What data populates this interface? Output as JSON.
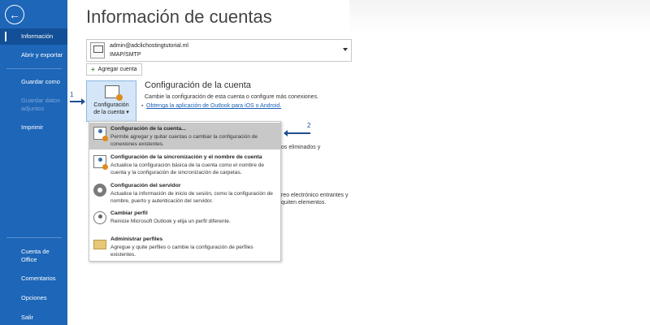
{
  "sidebar": {
    "back_icon": "back-arrow-icon",
    "items": [
      {
        "label": "Información",
        "active": true
      },
      {
        "label": "Abrir y exportar"
      },
      {
        "label": "Guardar como"
      },
      {
        "label": "Guardar datos adjuntos",
        "disabled": true
      },
      {
        "label": "Imprimir"
      },
      {
        "label": "Cuenta de Office"
      },
      {
        "label": "Comentarios"
      },
      {
        "label": "Opciones"
      },
      {
        "label": "Salir"
      }
    ],
    "color": "#1d66b8"
  },
  "page": {
    "title": "Información de cuentas"
  },
  "account": {
    "email": "admin@adclichostingtutorial.ml",
    "type": "IMAP/SMTP",
    "add_label": "Agregar cuenta"
  },
  "account_settings": {
    "button_label_line1": "Configuración",
    "button_label_line2": "de la cuenta",
    "section_title": "Configuración de la cuenta",
    "section_desc": "Cambie la configuración de esta cuenta o configure más conexiones.",
    "link": "Obtenga la aplicación de Outlook para iOS o Android."
  },
  "annotations": {
    "step1": "1",
    "step2": "2"
  },
  "background_text": {
    "frag1": "os eliminados y",
    "frag2": "reo electrónico entrantes y",
    "frag3": "quiten elementos."
  },
  "menu": {
    "items": [
      {
        "title": "Configuración de la cuenta...",
        "desc": "Permite agregar y quitar cuentas o cambiar la configuración de conexiones existentes.",
        "icon": "account-settings-icon",
        "hover": true
      },
      {
        "title": "Configuración de la sincronización y el nombre de cuenta",
        "desc": "Actualice la configuración básica de la cuenta como el nombre de cuenta y la configuración de sincronización de carpetas.",
        "icon": "sync-settings-icon"
      },
      {
        "title": "Configuración del servidor",
        "desc": "Actualice la información de inicio de sesión, como la configuración de nombre, puerto y autenticación del servidor.",
        "icon": "gear-icon"
      },
      {
        "title": "Cambiar perfil",
        "desc": "Reinicie Microsoft Outlook y elija un perfil diferente.",
        "icon": "change-profile-icon"
      },
      {
        "title": "Administrar perfiles",
        "desc": "Agregue y quite perfiles o cambie la configuración de perfiles existentes.",
        "icon": "manage-profiles-icon"
      }
    ]
  }
}
